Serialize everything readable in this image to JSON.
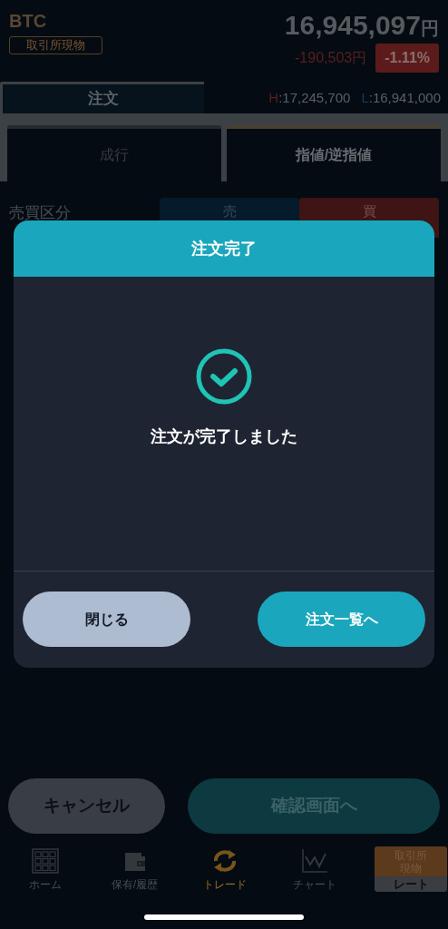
{
  "header": {
    "symbol": "BTC",
    "market_badge": "取引所現物",
    "price": "16,945,097",
    "price_unit": "円",
    "change": "-190,503円",
    "change_percent": "-1.11%"
  },
  "tabs": [
    {
      "label": "注文",
      "selected": true
    }
  ],
  "high_low": {
    "high_label": "H",
    "high": ":17,245,700",
    "low_label": "L",
    "low": ":16,941,000"
  },
  "order_types": [
    {
      "label": "成行",
      "selected": false
    },
    {
      "label": "指値/逆指値",
      "selected": true
    }
  ],
  "side": {
    "label": "売買区分",
    "options": [
      {
        "label": "売",
        "selected": false
      },
      {
        "label": "買",
        "selected": true
      }
    ]
  },
  "dialog": {
    "title": "注文完了",
    "message": "注文が完了しました",
    "buttons": [
      {
        "label": "閉じる",
        "kind": "secondary"
      },
      {
        "label": "注文一覧へ",
        "kind": "primary"
      }
    ]
  },
  "footer_buttons": [
    {
      "label": "キャンセル",
      "kind": "secondary"
    },
    {
      "label": "確認画面へ",
      "kind": "primary"
    }
  ],
  "nav": [
    {
      "label": "ホーム",
      "kind": "home",
      "selected": false
    },
    {
      "label": "保有/履歴",
      "kind": "wallet",
      "selected": false
    },
    {
      "label": "トレード",
      "kind": "trade",
      "selected": true
    },
    {
      "label": "チャート",
      "kind": "chart",
      "selected": false
    }
  ],
  "rate_tile": {
    "lines": [
      "取引所",
      "現物"
    ],
    "label": "レート"
  }
}
